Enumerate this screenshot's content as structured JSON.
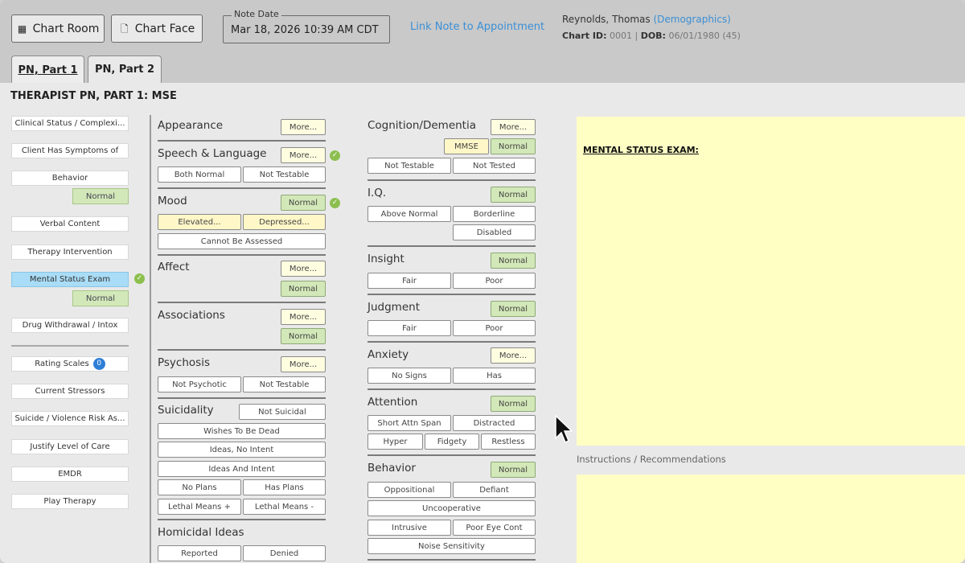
{
  "header": {
    "chart_room": "Chart Room",
    "chart_face": "Chart Face",
    "note_date_label": "Note Date",
    "note_date": "Mar 18, 2026 10:39 AM CDT",
    "link_note": "Link Note to Appointment",
    "patient_name": "Reynolds, Thomas",
    "demographics": "(Demographics)",
    "chart_id_label": "Chart ID:",
    "chart_id": "0001",
    "sep": "|",
    "dob_label": "DOB:",
    "dob": "06/01/1980 (45)"
  },
  "tabs": [
    "PN, Part 1",
    "PN, Part 2"
  ],
  "page_title": "THERAPIST PN, PART 1: MSE",
  "sidebar": {
    "items": [
      "Clinical Status / Complexi...",
      "Client Has Symptoms of",
      "Behavior",
      "Verbal Content",
      "Therapy Intervention",
      "Mental Status Exam",
      "Drug Withdrawal / Intox",
      "Rating Scales",
      "Current Stressors",
      "Suicide / Violence Risk As...",
      "Justify Level of Care",
      "EMDR",
      "Play Therapy"
    ],
    "normal": "Normal",
    "rating_count": "0"
  },
  "mid": {
    "appearance": "Appearance",
    "speech": "Speech & Language",
    "both_normal": "Both Normal",
    "not_testable": "Not Testable",
    "mood": "Mood",
    "elevated": "Elevated...",
    "depressed": "Depressed...",
    "cannot_assess": "Cannot Be Assessed",
    "affect": "Affect",
    "associations": "Associations",
    "psychosis": "Psychosis",
    "not_psychotic": "Not Psychotic",
    "suicidality": "Suicidality",
    "not_suicidal": "Not Suicidal",
    "wishes_dead": "Wishes To Be Dead",
    "ideas_no_intent": "Ideas, No Intent",
    "ideas_intent": "Ideas And Intent",
    "no_plans": "No Plans",
    "has_plans": "Has Plans",
    "lethal_plus": "Lethal Means +",
    "lethal_minus": "Lethal Means -",
    "homicidal": "Homicidal Ideas",
    "reported": "Reported",
    "denied": "Denied",
    "more": "More...",
    "normal": "Normal"
  },
  "right": {
    "cognition": "Cognition/Dementia",
    "mmse": "MMSE",
    "not_testable": "Not Testable",
    "not_tested": "Not Tested",
    "iq": "I.Q.",
    "above_normal": "Above Normal",
    "borderline": "Borderline",
    "disabled": "Disabled",
    "insight": "Insight",
    "fair": "Fair",
    "poor": "Poor",
    "judgment": "Judgment",
    "anxiety": "Anxiety",
    "no_signs": "No Signs",
    "has": "Has",
    "attention": "Attention",
    "short_attn": "Short Attn Span",
    "distracted": "Distracted",
    "hyper": "Hyper",
    "fidgety": "Fidgety",
    "restless": "Restless",
    "behavior": "Behavior",
    "oppositional": "Oppositional",
    "defiant": "Defiant",
    "uncooperative": "Uncooperative",
    "intrusive": "Intrusive",
    "poor_eye": "Poor Eye Cont",
    "noise": "Noise Sensitivity",
    "more": "More...",
    "normal": "Normal"
  },
  "note": {
    "title": "MENTAL STATUS EXAM:",
    "instructions": "Instructions / Recommendations"
  },
  "colors": {
    "accent_link": "#3a8fd6",
    "normal_green": "#d3e8b8",
    "note_yellow": "#ffffc4",
    "selected_blue": "#a9dcf6"
  }
}
